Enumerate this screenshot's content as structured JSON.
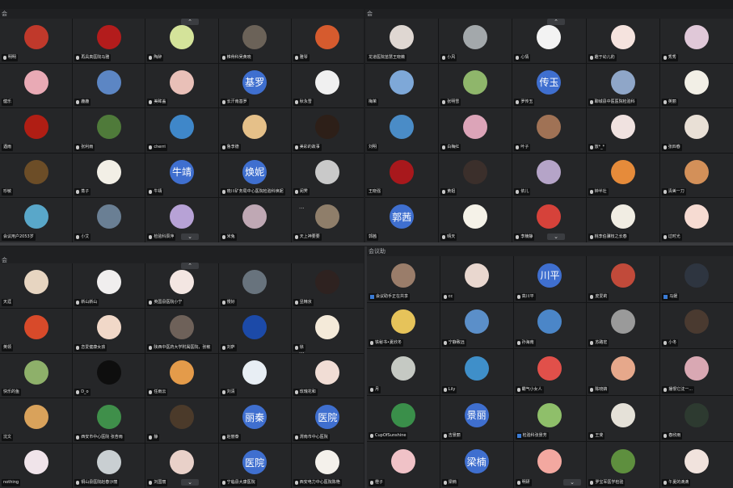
{
  "panels": [
    {
      "id": "tl",
      "title": "会",
      "scroll_up": "⌃",
      "scroll_down": "⌄",
      "dots": "···",
      "tiles": [
        {
          "name": "明明",
          "mic": true,
          "avatar": {
            "color": "#c0392b"
          }
        },
        {
          "name": "再具真医院马雅",
          "mic": true,
          "avatar": {
            "color": "#b31c1c"
          }
        },
        {
          "name": "陶醉",
          "mic": true,
          "avatar": {
            "color": "#d4e39a"
          }
        },
        {
          "name": "椎骨科吴黄晓",
          "mic": true,
          "avatar": {
            "color": "#6b6258"
          }
        },
        {
          "name": "雅琴",
          "mic": true,
          "avatar": {
            "color": "#d65b2e"
          }
        },
        {
          "name": "健乐",
          "mic": false,
          "avatar": {
            "color": "#e9aab5"
          }
        },
        {
          "name": "鹿鹿",
          "mic": true,
          "avatar": {
            "color": "#5c86c4"
          }
        },
        {
          "name": "美眸盖",
          "mic": true,
          "avatar": {
            "color": "#e9c0b8"
          }
        },
        {
          "name": "长汗南基罗",
          "mic": true,
          "avatar": {
            "color": "#3f6fcf",
            "text": "基罗"
          }
        },
        {
          "name": "秋永雪",
          "mic": true,
          "avatar": {
            "color": "#f0f0f0"
          }
        },
        {
          "name": "遇雨",
          "mic": false,
          "avatar": {
            "color": "#b01e14"
          }
        },
        {
          "name": "张利雨",
          "mic": true,
          "avatar": {
            "color": "#4f7a3a"
          }
        },
        {
          "name": "cherri",
          "mic": true,
          "avatar": {
            "color": "#3f87c9"
          }
        },
        {
          "name": "鲁李德",
          "mic": true,
          "avatar": {
            "color": "#e5c089"
          }
        },
        {
          "name": "美彩的故事",
          "mic": true,
          "avatar": {
            "color": "#2d1f18"
          }
        },
        {
          "name": "珍敏",
          "mic": false,
          "avatar": {
            "color": "#6c4d27"
          }
        },
        {
          "name": "蒸子",
          "mic": true,
          "avatar": {
            "color": "#f2efe6"
          }
        },
        {
          "name": "牛靖",
          "mic": true,
          "avatar": {
            "color": "#3f6fcf",
            "text": "牛靖"
          }
        },
        {
          "name": "晓川矿务局中心医院检验科焕妮",
          "mic": true,
          "avatar": {
            "color": "#3f6fcf",
            "text": "焕妮"
          }
        },
        {
          "name": "闵霁",
          "mic": true,
          "avatar": {
            "color": "#c9c9c9"
          }
        },
        {
          "name": "会议用户2053岁",
          "mic": false,
          "avatar": {
            "color": "#59a7c9"
          }
        },
        {
          "name": "小艾",
          "mic": true,
          "avatar": {
            "color": "#6a7f94"
          }
        },
        {
          "name": "检验科辰萍",
          "mic": true,
          "avatar": {
            "color": "#b7a2d6"
          }
        },
        {
          "name": "米兔",
          "mic": true,
          "avatar": {
            "color": "#bfa8b4"
          }
        },
        {
          "name": "天上神要要",
          "mic": true,
          "avatar": {
            "color": "#8f7e6a"
          }
        }
      ]
    },
    {
      "id": "tr",
      "title": "会",
      "scroll_up": "⌃",
      "scroll_down": "⌄",
      "tiles": [
        {
          "name": "龙道医院苗慧王晓薇",
          "mic": false,
          "avatar": {
            "color": "#dfd7d2"
          }
        },
        {
          "name": "小风",
          "mic": true,
          "avatar": {
            "color": "#a3a8ab"
          }
        },
        {
          "name": "心情",
          "mic": true,
          "avatar": {
            "color": "#f3f3f3"
          }
        },
        {
          "name": "趣于幼儿豹",
          "mic": true,
          "avatar": {
            "color": "#f5e3de"
          }
        },
        {
          "name": "秀秀",
          "mic": true,
          "avatar": {
            "color": "#e0c8d8"
          }
        },
        {
          "name": "梅茉",
          "mic": false,
          "avatar": {
            "color": "#7ea8d8"
          }
        },
        {
          "name": "张明雪",
          "mic": true,
          "avatar": {
            "color": "#8fb66b"
          }
        },
        {
          "name": "罗传玉",
          "mic": true,
          "avatar": {
            "color": "#3f6fcf",
            "text": "传玉"
          }
        },
        {
          "name": "聊城县中医医院检验科",
          "mic": true,
          "avatar": {
            "color": "#8fa6c8"
          }
        },
        {
          "name": "英丽",
          "mic": true,
          "avatar": {
            "color": "#f2efe6"
          }
        },
        {
          "name": "刘明",
          "mic": false,
          "avatar": {
            "color": "#4a8cc7"
          }
        },
        {
          "name": "白梅红",
          "mic": true,
          "avatar": {
            "color": "#dca4b8"
          }
        },
        {
          "name": "叶子",
          "mic": true,
          "avatar": {
            "color": "#a07255"
          }
        },
        {
          "name": "放*_*",
          "mic": true,
          "avatar": {
            "color": "#f0e2e0"
          }
        },
        {
          "name": "张四春",
          "mic": true,
          "avatar": {
            "color": "#e9e0d6"
          }
        },
        {
          "name": "王晓强",
          "mic": false,
          "avatar": {
            "color": "#a8181c"
          }
        },
        {
          "name": "黄姐",
          "mic": true,
          "avatar": {
            "color": "#3b2f2b"
          }
        },
        {
          "name": "依儿",
          "mic": true,
          "avatar": {
            "color": "#b5a4c8"
          }
        },
        {
          "name": "钟半壮",
          "mic": true,
          "avatar": {
            "color": "#e68b3a"
          }
        },
        {
          "name": "清美一刀",
          "mic": true,
          "avatar": {
            "color": "#d39059"
          }
        },
        {
          "name": "郭茜",
          "mic": false,
          "avatar": {
            "color": "#3f6fcf",
            "text": "郭茜"
          }
        },
        {
          "name": "晴天",
          "mic": true,
          "avatar": {
            "color": "#f5f2e8"
          }
        },
        {
          "name": "李楠静",
          "mic": true,
          "avatar": {
            "color": "#d6423a"
          }
        },
        {
          "name": "桃李伯骥枝之长春",
          "mic": true,
          "avatar": {
            "color": "#f1ede3"
          }
        },
        {
          "name": "过时光",
          "mic": true,
          "avatar": {
            "color": "#f6dbd2"
          }
        }
      ]
    },
    {
      "id": "bl",
      "title": "会",
      "scroll_up": "⌃",
      "scroll_down": "⌄",
      "dots": "···",
      "tiles": [
        {
          "name": "天涯",
          "mic": false,
          "avatar": {
            "color": "#e7d5c1"
          }
        },
        {
          "name": "新山新山",
          "mic": true,
          "avatar": {
            "color": "#f0eeee"
          }
        },
        {
          "name": "英国县医院小宁",
          "mic": true,
          "avatar": {
            "color": "#f3e6e2"
          }
        },
        {
          "name": "慢好",
          "mic": true,
          "avatar": {
            "color": "#68737d"
          }
        },
        {
          "name": "昱精京",
          "mic": true,
          "avatar": {
            "color": "#2e2220"
          }
        },
        {
          "name": "英领",
          "mic": false,
          "avatar": {
            "color": "#d84a2a"
          }
        },
        {
          "name": "恋爱健康女孩",
          "mic": true,
          "avatar": {
            "color": "#f1d8c8"
          }
        },
        {
          "name": "陕西中医药大学附属医院，张敏",
          "mic": true,
          "avatar": {
            "color": "#6e6159"
          }
        },
        {
          "name": "刘萨",
          "mic": true,
          "avatar": {
            "color": "#1c4aa8"
          }
        },
        {
          "name": "徐",
          "mic": true,
          "avatar": {
            "color": "#f4ead9"
          }
        },
        {
          "name": "快乐的鱼",
          "mic": false,
          "avatar": {
            "color": "#8eb06a"
          }
        },
        {
          "name": "D_o",
          "mic": true,
          "avatar": {
            "color": "#0e0e0e"
          }
        },
        {
          "name": "任雨云",
          "mic": true,
          "avatar": {
            "color": "#e49b4a"
          }
        },
        {
          "name": "刘清",
          "mic": true,
          "avatar": {
            "color": "#e8eef4"
          }
        },
        {
          "name": "玫瑰花和",
          "mic": true,
          "avatar": {
            "color": "#f1ddd5"
          }
        },
        {
          "name": "沈文",
          "mic": false,
          "avatar": {
            "color": "#d9a25b"
          }
        },
        {
          "name": "西安市中心医院 张杏雨",
          "mic": true,
          "avatar": {
            "color": "#3f8f4a"
          }
        },
        {
          "name": "静",
          "mic": true,
          "avatar": {
            "color": "#4b3a2a"
          }
        },
        {
          "name": "赵丽泰",
          "mic": true,
          "avatar": {
            "color": "#3f6fcf",
            "text": "丽秦"
          }
        },
        {
          "name": "渭南市中心医院",
          "mic": true,
          "avatar": {
            "color": "#3f6fcf",
            "text": "医院"
          }
        },
        {
          "name": "nothing",
          "mic": false,
          "avatar": {
            "color": "#f0e4ea"
          }
        },
        {
          "name": "铜山县医院赵春沙丽",
          "mic": true,
          "avatar": {
            "color": "#c9cfd2"
          }
        },
        {
          "name": "刘国丽",
          "mic": true,
          "avatar": {
            "color": "#e9d1c9"
          }
        },
        {
          "name": "宁临县大康医院",
          "mic": true,
          "avatar": {
            "color": "#3f6fcf",
            "text": "医院"
          }
        },
        {
          "name": "西安电力中心医院陈艳",
          "mic": true,
          "avatar": {
            "color": "#f4f1eb"
          }
        }
      ]
    },
    {
      "id": "br",
      "title": "会议助",
      "scroll_down": "⌄",
      "tiles": [
        {
          "name": "会议助手正在共享",
          "mic": false,
          "host": true,
          "avatar": {
            "color": "#9a7d6a"
          }
        },
        {
          "name": "cc",
          "mic": true,
          "avatar": {
            "color": "#e9d7cf"
          }
        },
        {
          "name": "高川平",
          "mic": true,
          "avatar": {
            "color": "#3f6fcf",
            "text": "川平"
          }
        },
        {
          "name": "皮爱莉",
          "mic": true,
          "avatar": {
            "color": "#c14a3a"
          }
        },
        {
          "name": "马媛",
          "mic": false,
          "host": true,
          "avatar": {
            "color": "#2e3540"
          }
        },
        {
          "name": "铁秘书•夏欣冬",
          "mic": true,
          "avatar": {
            "color": "#e6c35a"
          }
        },
        {
          "name": "宁静致远",
          "mic": true,
          "avatar": {
            "color": "#5b8fc9"
          }
        },
        {
          "name": "孙海南",
          "mic": true,
          "avatar": {
            "color": "#4b86c8"
          }
        },
        {
          "name": "苏路宏",
          "mic": true,
          "avatar": {
            "color": "#9a9a9a"
          }
        },
        {
          "name": "小冬",
          "mic": true,
          "avatar": {
            "color": "#4a3a30"
          }
        },
        {
          "name": "月",
          "mic": true,
          "avatar": {
            "color": "#c5c9c3"
          }
        },
        {
          "name": "Lily",
          "mic": true,
          "avatar": {
            "color": "#3f8fc9"
          }
        },
        {
          "name": "霸气小女人",
          "mic": true,
          "avatar": {
            "color": "#e1504a"
          }
        },
        {
          "name": "陈晓婧",
          "mic": true,
          "avatar": {
            "color": "#e6a88b"
          }
        },
        {
          "name": "播恨它沈一...",
          "mic": true,
          "avatar": {
            "color": "#d9a8b3"
          }
        },
        {
          "name": "CupOfSunshine",
          "mic": true,
          "avatar": {
            "color": "#3a8f4a"
          }
        },
        {
          "name": "吉景丽",
          "mic": true,
          "avatar": {
            "color": "#3f6fcf",
            "text": "景丽"
          }
        },
        {
          "name": "检验科张景芳",
          "mic": false,
          "host": true,
          "avatar": {
            "color": "#8fbf6a"
          }
        },
        {
          "name": "王斐",
          "mic": true,
          "avatar": {
            "color": "#e5e1d8"
          }
        },
        {
          "name": "春欣雨",
          "mic": true,
          "avatar": {
            "color": "#2d3a30"
          }
        },
        {
          "name": "橙子",
          "mic": true,
          "avatar": {
            "color": "#f0c2c7"
          }
        },
        {
          "name": "梁楠",
          "mic": true,
          "avatar": {
            "color": "#3f6fcf",
            "text": "梁楠"
          }
        },
        {
          "name": "明研",
          "mic": true,
          "avatar": {
            "color": "#f3a8a0"
          }
        },
        {
          "name": "罗宝军医学检验",
          "mic": true,
          "avatar": {
            "color": "#5e8f3e"
          }
        },
        {
          "name": "午夏的滴滴",
          "mic": true,
          "avatar": {
            "color": "#f1e3dd"
          }
        }
      ]
    }
  ]
}
